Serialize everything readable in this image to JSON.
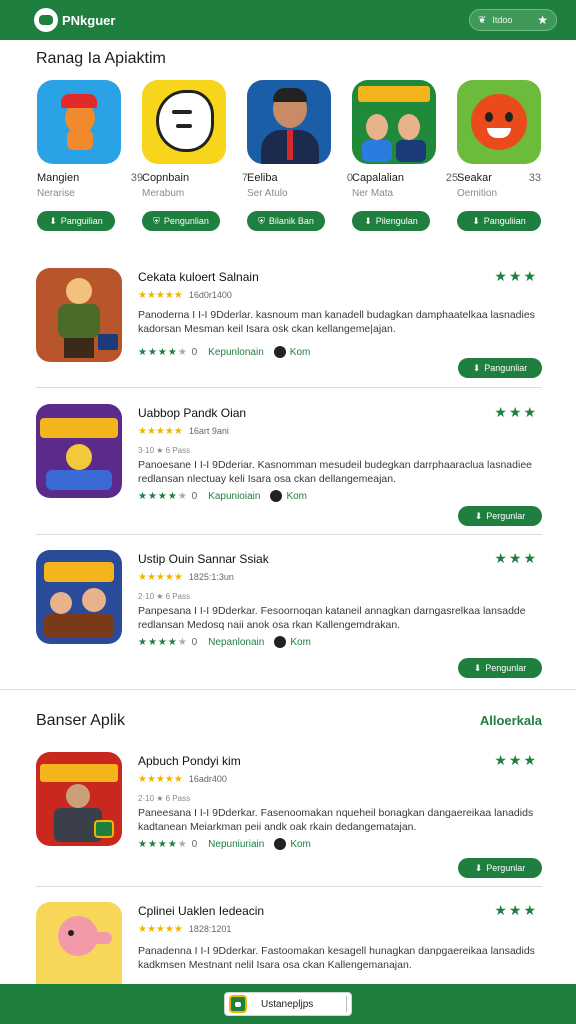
{
  "header": {
    "brand": "PNkguer",
    "pill_label": "Itdoo",
    "pill_icon": "leaf-icon",
    "pill_star": "★"
  },
  "featured": {
    "title": "Ranag Ia Apiaktim",
    "items": [
      {
        "name": "Mangien",
        "num": "39",
        "sub": "Nerarise",
        "button": "Panguilian",
        "bg": "#2aa3e6"
      },
      {
        "name": "Copnbain",
        "num": "7",
        "sub": "Merabum",
        "button": "Pengunlian",
        "bg": "#f6d51b"
      },
      {
        "name": "Eeliba",
        "num": "0",
        "sub": "Ser Atulo",
        "button": "Bilanik Ban",
        "bg": "#1b5ea8"
      },
      {
        "name": "Capalalian",
        "num": "25",
        "sub": "Ner Mata",
        "button": "Pilengulan",
        "bg": "#1e8a3a"
      },
      {
        "name": "Seakar",
        "num": "33",
        "sub": "Oemition",
        "button": "Panguliian",
        "bg": "#6cbb3c"
      }
    ]
  },
  "list": [
    {
      "title": "Cekata kuloert Salnain",
      "rating_stars": "★★★★★",
      "rating_text": "16d0r1400",
      "meta": "",
      "desc": "Panoderna I I-I 9Dderlar. kasnoum man kanadell budagkan damphaatelkaa lasnadies kadorsan Mesman keil Isara osk ckan kellangeme|ajan.",
      "green_stars": "★★★★",
      "grey_star": "★",
      "zero": "0",
      "category": "Kepunlonain",
      "developer": "Kom",
      "button": "Pangunliar",
      "right_stars": "★★★"
    },
    {
      "title": "Uabbop Pandk Oian",
      "rating_stars": "★★★★★",
      "rating_text": "16art 9ani",
      "meta": "3·10 ★ 6 Pass",
      "desc": "Panoesane I I-I 9Dderiar. Kasnomman mesudeil budegkan darrphaaraclua lasnadiee redlansan nlectuay keli Isara osa ckan dellangemeajan.",
      "green_stars": "★★★★",
      "grey_star": "★",
      "zero": "0",
      "category": "Kapunioiain",
      "developer": "Kom",
      "button": "Pergunlar",
      "right_stars": "★★★"
    },
    {
      "title": "Ustip Ouin Sannar Ssiak",
      "rating_stars": "★★★★★",
      "rating_text": "1825:1:3un",
      "meta": "2·10 ★ 6 Pass",
      "desc": "Panpesana I I-I 9Dderkar. Fesoornoqan kataneil annagkan darngasrelkaa lansadde redlansan Medosq naii anok osa rkan Kallengemdrakan.",
      "green_stars": "★★★★",
      "grey_star": "★",
      "zero": "0",
      "category": "Nepanlonain",
      "developer": "Kom",
      "button": "Pengunlar",
      "right_stars": "★★★"
    }
  ],
  "second": {
    "title": "Banser Aplik",
    "link": "Alloerkala"
  },
  "list2": [
    {
      "title": "Apbuch Pondyi kim",
      "rating_stars": "★★★★★",
      "rating_text": "16adr400",
      "meta": "2·10 ★ 6 Pass",
      "desc": "Paneesana I I-I 9Dderkar. Fasenoomakan nqueheil bonagkan dangaereikaa lanadids kadtanean Meiarkman peii andk oak rkain dedangematajan.",
      "green_stars": "★★★★",
      "grey_star": "★",
      "zero": "0",
      "category": "Nepuniuriain",
      "developer": "Kom",
      "button": "Pergunlar",
      "right_stars": "★★★"
    },
    {
      "title": "Cplinei Uaklen Iedeacin",
      "rating_stars": "★★★★★",
      "rating_text": "1828:1201",
      "desc": "Panadenna I I-I 9Dderkar. Fastoomakan kesagell hunagkan danpgaereikaa lansadids kadkmsen Mestnant nelil Isara osa ckan Kallengemanajan.",
      "right_stars": "★★★"
    }
  ],
  "bottom": {
    "label": "Ustanepljps"
  }
}
